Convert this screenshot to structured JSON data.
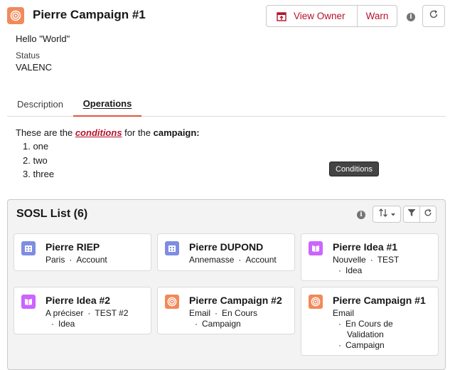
{
  "header": {
    "title": "Pierre Campaign #1",
    "icon": "campaign-icon",
    "view_owner_label": "View Owner",
    "warn_label": "Warn",
    "info_glyph": "i"
  },
  "fields": {
    "hello": "Hello \"World\"",
    "status_label": "Status",
    "status_value": "VALENC"
  },
  "tabs": [
    {
      "label": "Description",
      "active": false
    },
    {
      "label": "Operations",
      "active": true
    }
  ],
  "operations": {
    "intro_prefix": "These are the ",
    "conditions_link": "conditions",
    "intro_middle": " for the ",
    "campaign_word": "campaign:",
    "list": [
      "1. one",
      "2. two",
      "3. three"
    ],
    "tooltip": "Conditions"
  },
  "sosl": {
    "title": "SOSL List (6)",
    "info_glyph": "i",
    "tiles": [
      {
        "title": "Pierre RIEP",
        "icon": "account-icon",
        "color": "#7f8de1",
        "lines": [
          "Paris",
          "Account"
        ]
      },
      {
        "title": "Pierre DUPOND",
        "icon": "account-icon",
        "color": "#7f8de1",
        "lines": [
          "Annemasse",
          "Account"
        ]
      },
      {
        "title": "Pierre Idea #1",
        "icon": "idea-icon",
        "color": "#cb65ff",
        "lines": [
          "Nouvelle",
          "TEST",
          "Idea"
        ]
      },
      {
        "title": "Pierre Idea #2",
        "icon": "idea-icon",
        "color": "#cb65ff",
        "lines": [
          "A préciser",
          "TEST #2",
          "Idea"
        ]
      },
      {
        "title": "Pierre Campaign #2",
        "icon": "campaign-icon",
        "color": "#f2895a",
        "lines": [
          "Email",
          "En Cours",
          "Campaign"
        ]
      },
      {
        "title": "Pierre Campaign #1",
        "icon": "campaign-icon",
        "color": "#f2895a",
        "lines": [
          "Email",
          "En Cours de",
          "Validation",
          "Campaign"
        ]
      }
    ]
  },
  "colors": {
    "brand_red": "#b5122c",
    "tab_active_border": "#e0563d",
    "campaign": "#f2895a",
    "account": "#7f8de1",
    "idea": "#cb65ff"
  }
}
